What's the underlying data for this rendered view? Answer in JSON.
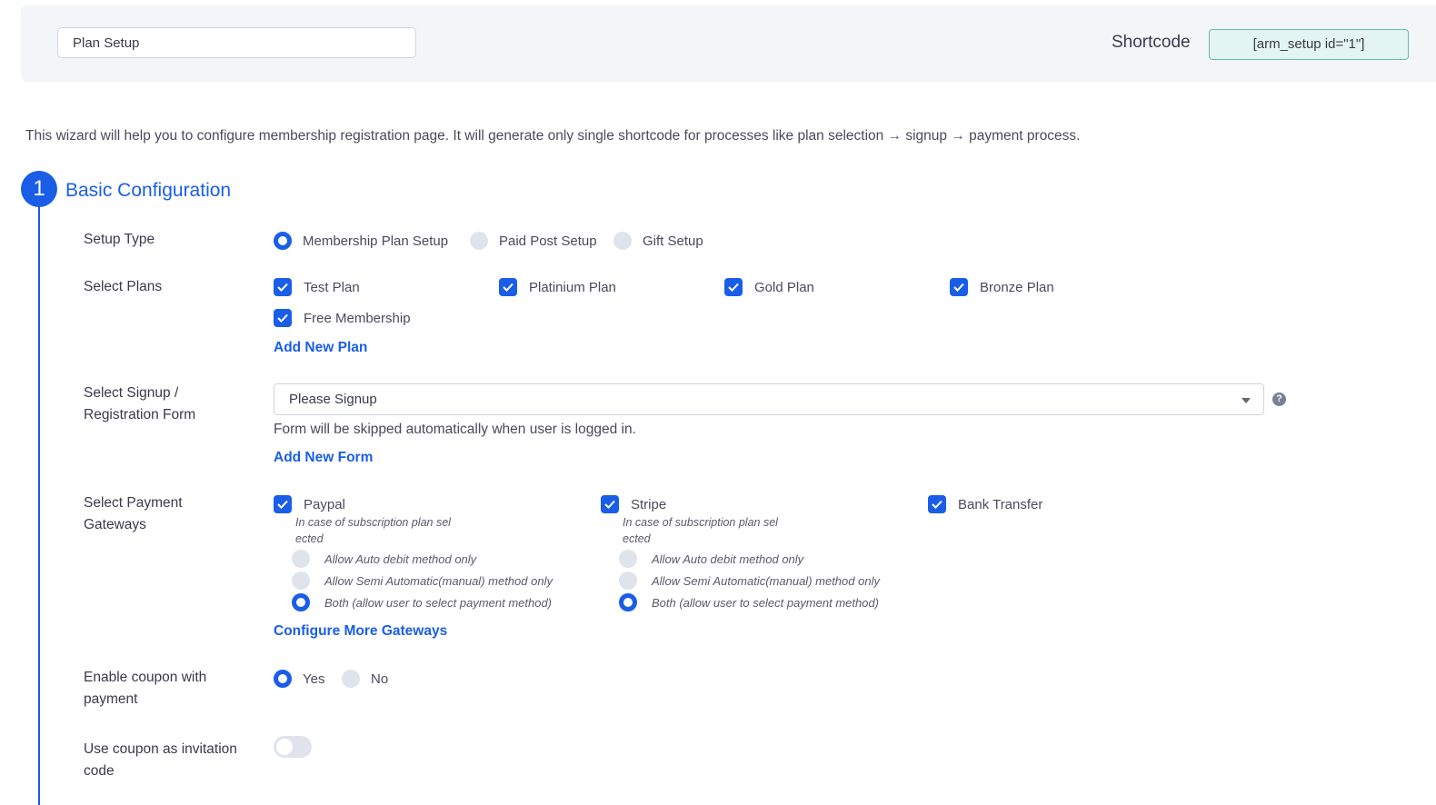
{
  "header": {
    "setup_name": "Plan Setup",
    "shortcode_label": "Shortcode",
    "shortcode_value": "[arm_setup id=\"1\"]"
  },
  "intro_text": "This wizard will help you to configure membership registration page. It will generate only single shortcode for processes like plan selection → signup → payment process.",
  "step": {
    "number": "1",
    "title": "Basic Configuration"
  },
  "setup_type": {
    "label": "Setup Type",
    "options": [
      {
        "label": "Membership Plan Setup",
        "selected": true
      },
      {
        "label": "Paid Post Setup",
        "selected": false
      },
      {
        "label": "Gift Setup",
        "selected": false
      }
    ]
  },
  "plans": {
    "label": "Select Plans",
    "items": [
      "Test Plan",
      "Platinium Plan",
      "Gold Plan",
      "Bronze Plan",
      "Free Membership"
    ],
    "add_link": "Add New Plan"
  },
  "signup": {
    "label_line1": "Select Signup /",
    "label_line2": "Registration Form",
    "selected": "Please Signup",
    "hint": "Form will be skipped automatically when user is logged in.",
    "add_link": "Add New Form",
    "help_icon": "question-circle-icon"
  },
  "gateways": {
    "label_line1": "Select Payment",
    "label_line2": "Gateways",
    "items": [
      {
        "name": "Paypal",
        "note_line1": "In case of subscription plan sel",
        "note_line2": "ected",
        "modes": [
          {
            "label": "Allow Auto debit method only",
            "selected": false
          },
          {
            "label": "Allow Semi Automatic(manual) method only",
            "selected": false
          },
          {
            "label": "Both (allow user to select payment method)",
            "selected": true
          }
        ]
      },
      {
        "name": "Stripe",
        "note_line1": "In case of subscription plan sel",
        "note_line2": "ected",
        "modes": [
          {
            "label": "Allow Auto debit method only",
            "selected": false
          },
          {
            "label": "Allow Semi Automatic(manual) method only",
            "selected": false
          },
          {
            "label": "Both (allow user to select payment method)",
            "selected": true
          }
        ]
      },
      {
        "name": "Bank Transfer"
      }
    ],
    "configure_link": "Configure More Gateways"
  },
  "coupon": {
    "label_line1": "Enable coupon with",
    "label_line2": "payment",
    "yes": "Yes",
    "no": "No",
    "selected": "yes"
  },
  "invitation": {
    "label_line1": "Use coupon as invitation",
    "label_line2": "code",
    "enabled": false
  },
  "colors": {
    "accent": "#1a5ee8",
    "shortcode_bg": "#e3f5f2",
    "shortcode_border": "#5cc3b0"
  }
}
